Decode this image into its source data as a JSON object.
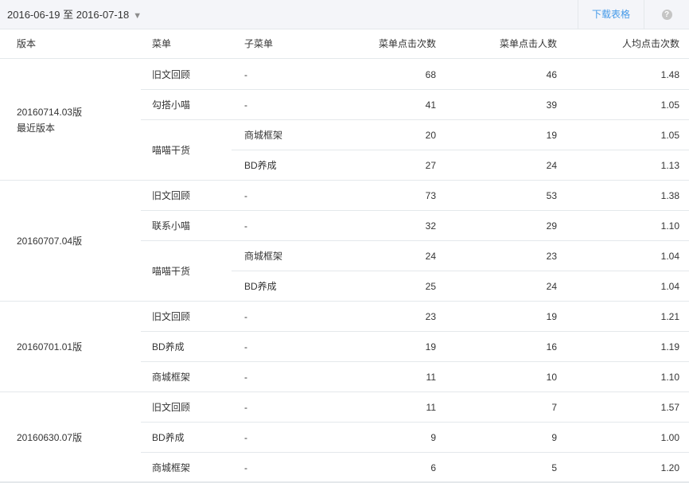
{
  "toolbar": {
    "date_range": "2016-06-19 至 2016-07-18",
    "dropdown_caret": "▼",
    "download_label": "下载表格",
    "help_icon": "?"
  },
  "table": {
    "headers": [
      "版本",
      "菜单",
      "子菜单",
      "菜单点击次数",
      "菜单点击人数",
      "人均点击次数"
    ],
    "groups": [
      {
        "version_lines": [
          "20160714.03版",
          "最近版本"
        ],
        "rows": [
          {
            "menu": "旧文回顾",
            "sub": "-",
            "clicks": "68",
            "users": "46",
            "avg": "1.48"
          },
          {
            "menu": "勾搭小喵",
            "sub": "-",
            "clicks": "41",
            "users": "39",
            "avg": "1.05"
          },
          {
            "menu": "喵喵干货",
            "sub": "商城框架",
            "clicks": "20",
            "users": "19",
            "avg": "1.05"
          },
          {
            "menu": "",
            "sub": "BD养成",
            "clicks": "27",
            "users": "24",
            "avg": "1.13"
          }
        ]
      },
      {
        "version_lines": [
          "20160707.04版"
        ],
        "rows": [
          {
            "menu": "旧文回顾",
            "sub": "-",
            "clicks": "73",
            "users": "53",
            "avg": "1.38"
          },
          {
            "menu": "联系小喵",
            "sub": "-",
            "clicks": "32",
            "users": "29",
            "avg": "1.10"
          },
          {
            "menu": "喵喵干货",
            "sub": "商城框架",
            "clicks": "24",
            "users": "23",
            "avg": "1.04"
          },
          {
            "menu": "",
            "sub": "BD养成",
            "clicks": "25",
            "users": "24",
            "avg": "1.04"
          }
        ]
      },
      {
        "version_lines": [
          "20160701.01版"
        ],
        "rows": [
          {
            "menu": "旧文回顾",
            "sub": "-",
            "clicks": "23",
            "users": "19",
            "avg": "1.21"
          },
          {
            "menu": "BD养成",
            "sub": "-",
            "clicks": "19",
            "users": "16",
            "avg": "1.19"
          },
          {
            "menu": "商城框架",
            "sub": "-",
            "clicks": "11",
            "users": "10",
            "avg": "1.10"
          }
        ]
      },
      {
        "version_lines": [
          "20160630.07版"
        ],
        "rows": [
          {
            "menu": "旧文回顾",
            "sub": "-",
            "clicks": "11",
            "users": "7",
            "avg": "1.57"
          },
          {
            "menu": "BD养成",
            "sub": "-",
            "clicks": "9",
            "users": "9",
            "avg": "1.00"
          },
          {
            "menu": "商城框架",
            "sub": "-",
            "clicks": "6",
            "users": "5",
            "avg": "1.20"
          }
        ]
      }
    ]
  }
}
